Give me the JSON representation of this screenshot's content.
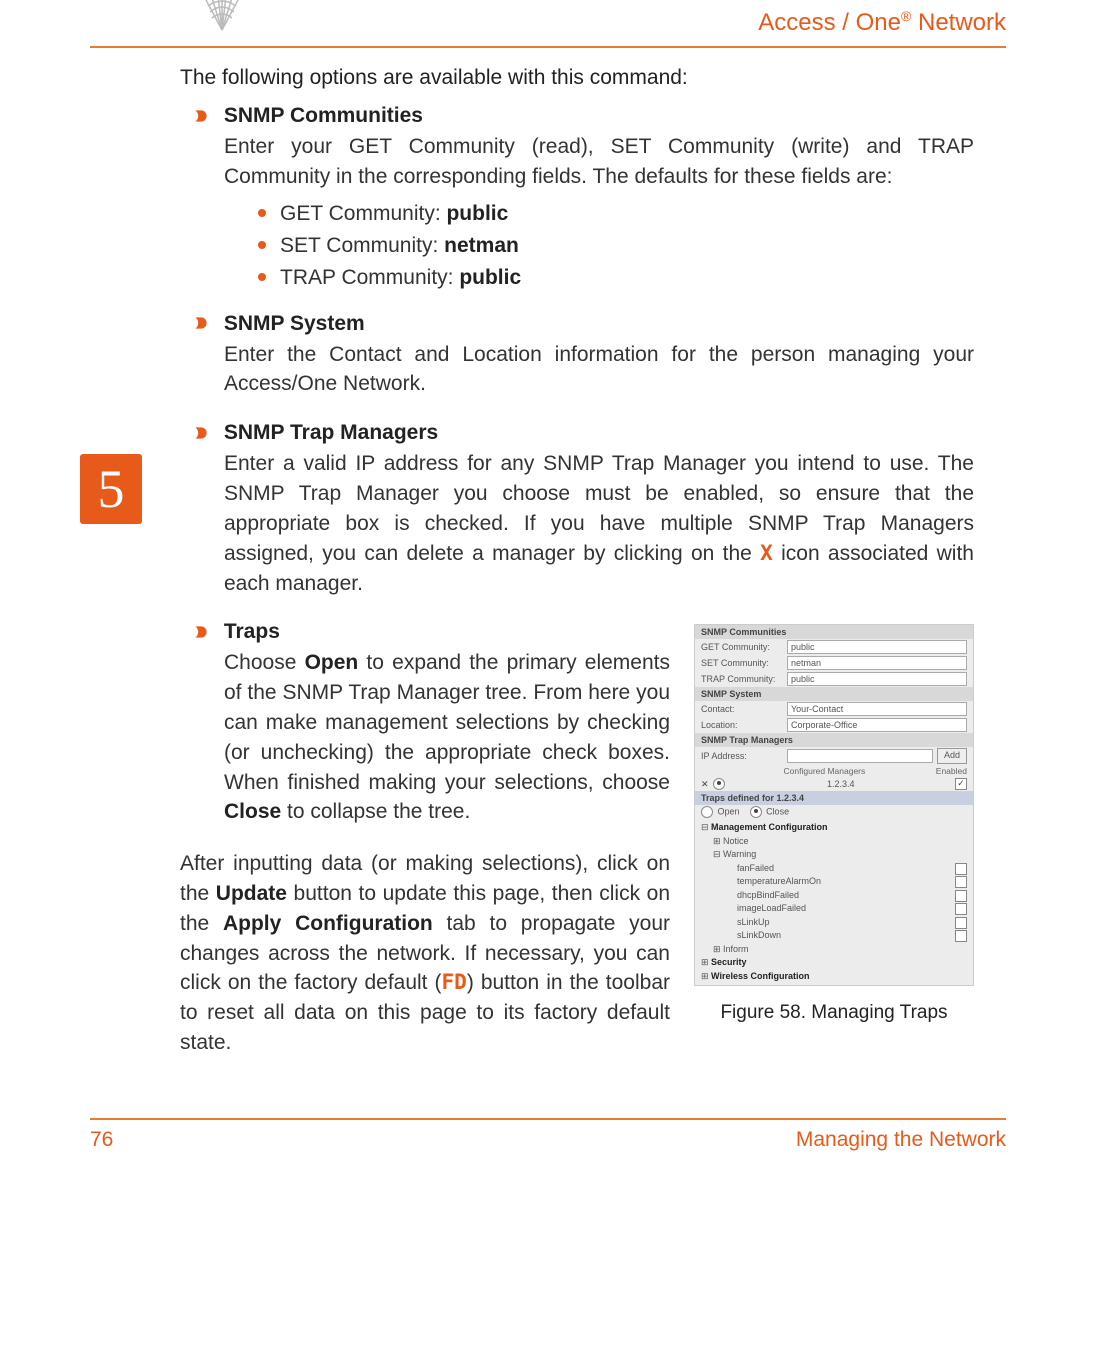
{
  "header": {
    "brand": "Access / One",
    "reg": "®",
    "brand_suffix": " Network"
  },
  "chapter_tab": "5",
  "intro": "The following options are available with this command:",
  "sections": {
    "snmp_communities": {
      "title": "SNMP Communities",
      "body": "Enter your GET Community (read), SET Community (write) and TRAP Community in the corresponding fields. The defaults for these fields are:",
      "items": {
        "get": {
          "label": "GET Community: ",
          "value": "public"
        },
        "set": {
          "label": "SET Community: ",
          "value": "netman"
        },
        "trap": {
          "label": "TRAP Community: ",
          "value": "public"
        }
      }
    },
    "snmp_system": {
      "title": "SNMP System",
      "body": "Enter the Contact and Location information for the person managing your Access/One Network."
    },
    "snmp_trap_mgr": {
      "title": "SNMP Trap Managers",
      "body_pre": "Enter a valid IP address for any SNMP Trap Manager you intend to use. The SNMP Trap Manager you choose must be enabled, so ensure that the appropriate box is checked. If you have multiple SNMP Trap Managers assigned, you can delete a manager by clicking on the ",
      "x": "X",
      "body_post": " icon associated with each manager."
    },
    "traps": {
      "title": "Traps",
      "body_pre": "Choose ",
      "open": "Open",
      "body_mid": " to expand the primary elements of the SNMP Trap Manager tree. From here you can make management selections by checking (or unchecking) the appropriate check boxes. When finished making your selections, choose ",
      "close": "Close",
      "body_post": " to collapse the tree."
    }
  },
  "after": {
    "p1_pre": "After inputting data (or making selections), click on the ",
    "update": "Update",
    "p1_mid": " button to update this page, then click on the ",
    "apply": "Apply Configuration",
    "p1_mid2": " tab to propagate your changes across the network. If necessary, you can click on the factory default (",
    "fd": "FD",
    "p1_post": ") button in the toolbar to reset all data on this page to its factory default state."
  },
  "figure": {
    "caption": "Figure 58. Managing Traps",
    "panel": {
      "h_comm": "SNMP Communities",
      "lbl_get": "GET Community:",
      "val_get": "public",
      "lbl_set": "SET Community:",
      "val_set": "netman",
      "lbl_trap": "TRAP Community:",
      "val_trap": "public",
      "h_sys": "SNMP System",
      "lbl_contact": "Contact:",
      "val_contact": "Your-Contact",
      "lbl_loc": "Location:",
      "val_loc": "Corporate-Office",
      "h_mgr": "SNMP Trap Managers",
      "lbl_ip": "IP Address:",
      "btn_add": "Add",
      "col_cfg": "Configured Managers",
      "col_en": "Enabled",
      "row_ip": "1.2.3.4",
      "h_traps": "Traps defined for 1.2.3.4",
      "r_open": "Open",
      "r_close": "Close",
      "n_mgmt": "Management Configuration",
      "n_notice": "Notice",
      "n_warn": "Warning",
      "w1": "fanFailed",
      "w2": "temperatureAlarmOn",
      "w3": "dhcpBindFailed",
      "w4": "imageLoadFailed",
      "w5": "sLinkUp",
      "w6": "sLinkDown",
      "n_inform": "Inform",
      "n_sec": "Security",
      "n_wless": "Wireless Configuration"
    }
  },
  "footer": {
    "page": "76",
    "section": "Managing the Network"
  }
}
